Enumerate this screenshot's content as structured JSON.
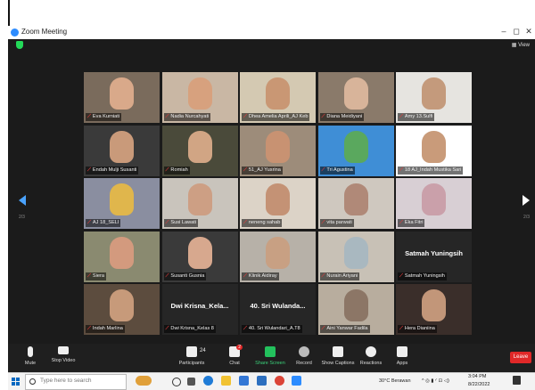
{
  "window": {
    "title": "Zoom Meeting",
    "minimize": "–",
    "maximize": "◻",
    "close": "✕"
  },
  "topbar": {
    "view_label": "View"
  },
  "page": {
    "left": "2/3",
    "right": "2/3"
  },
  "participants": [
    {
      "name": "Eva Kurniati",
      "video": true,
      "bg": "#7a6b5c",
      "face": "#d9a98a"
    },
    {
      "name": "Nadia Nurcahyati",
      "video": true,
      "bg": "#c9b7a4",
      "face": "#d7a17e"
    },
    {
      "name": "Dhea Amelia Aprili_AJ Keb",
      "video": true,
      "bg": "#d4c9b2",
      "face": "#c99774"
    },
    {
      "name": "Diana Meidiyani",
      "video": true,
      "bg": "#8a7a6a",
      "face": "#d8b49a"
    },
    {
      "name": "Amy 13.Sulfi",
      "video": true,
      "bg": "#e6e4e0",
      "face": "#c49a7c"
    },
    {
      "name": "Endah Mulji Susanti",
      "video": true,
      "bg": "#3a3a3a",
      "face": "#c99a7a"
    },
    {
      "name": "Romiah",
      "video": true,
      "bg": "#4a4a3a",
      "face": "#d1a584"
    },
    {
      "name": "51_AJ Yusrina",
      "video": true,
      "bg": "#9d8c7a",
      "face": "#c89272"
    },
    {
      "name": "Tri Agustina",
      "video": true,
      "bg": "#3f8ed6",
      "face": "#5aa85e"
    },
    {
      "name": "18 AJ_Indah Mustika Sari",
      "video": true,
      "bg": "#ffffff",
      "face": "#c99b7a"
    },
    {
      "name": "AJ 18_SELI",
      "video": true,
      "bg": "#8a8ea0",
      "face": "#e0b64c"
    },
    {
      "name": "Susi Lawati",
      "video": true,
      "bg": "#c9c4bc",
      "face": "#cd9f84"
    },
    {
      "name": "neneng sahab",
      "video": true,
      "bg": "#dcd3c7",
      "face": "#c49275"
    },
    {
      "name": "vita parwati",
      "video": true,
      "bg": "#cfc8bf",
      "face": "#b08978"
    },
    {
      "name": "Eka Fitri",
      "video": true,
      "bg": "#d8cfd4",
      "face": "#caa0aa"
    },
    {
      "name": "Siera",
      "video": true,
      "bg": "#8a8a70",
      "face": "#d39a7e"
    },
    {
      "name": "Susanti Gusnia",
      "video": true,
      "bg": "#3a3a3a",
      "face": "#d7a88e"
    },
    {
      "name": "Klinik Aidiray",
      "video": true,
      "bg": "#b7b1a8",
      "face": "#c8a083"
    },
    {
      "name": "Nurain Ariyani",
      "video": true,
      "bg": "#c8c1b6",
      "face": "#a9b8c0"
    },
    {
      "name": "Satmah Yuningsih",
      "video": false,
      "display": "Satmah Yuningsih"
    },
    {
      "name": "Indah Marlina",
      "video": true,
      "bg": "#5c4c3e",
      "face": "#c79a7a"
    },
    {
      "name": "Dwi Krisna_Kelas 8",
      "video": false,
      "display": "Dwi Krisna_Kela..."
    },
    {
      "name": "40. Sri Wulandari_A.T8",
      "video": false,
      "display": "40. Sri Wulanda..."
    },
    {
      "name": "Aini Yanwar Fadila",
      "video": true,
      "bg": "#b8ad9e",
      "face": "#8c7666"
    },
    {
      "name": "Hera Dianiina",
      "video": true,
      "bg": "#3a2e2a",
      "face": "#c29679"
    }
  ],
  "toolbar": {
    "mute": "Mute",
    "stop_video": "Stop Video",
    "participants": "Participants",
    "participants_count": "24",
    "chat": "Chat",
    "chat_badge": "2",
    "share_screen": "Share Screen",
    "record": "Record",
    "show_captions": "Show Captions",
    "reactions": "Reactions",
    "apps": "Apps",
    "leave": "Leave"
  },
  "taskbar": {
    "search_placeholder": "Type here to search",
    "weather": "30°C Berawan",
    "time": "3:04 PM",
    "date": "8/22/2022"
  },
  "colors": {
    "accent": "#2d8cff",
    "leave": "#e02828",
    "share": "#23c15d",
    "mute_icon": "#e53c3c"
  }
}
